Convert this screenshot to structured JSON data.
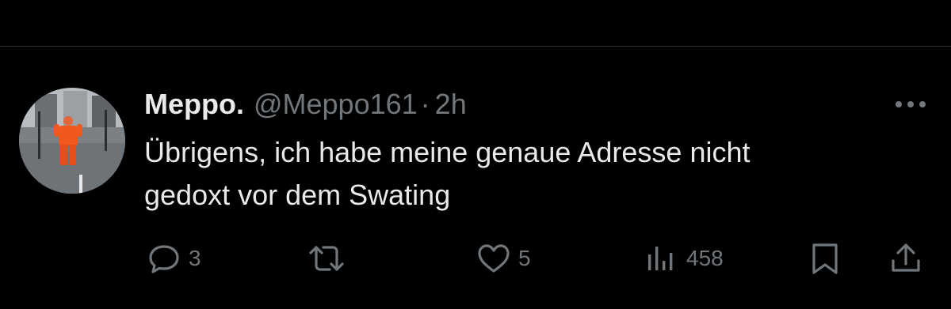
{
  "tweet": {
    "display_name": "Meppo.",
    "handle": "@Meppo161",
    "separator": "·",
    "time": "2h",
    "text": "Übrigens, ich habe meine genaue Adresse nicht\ngedoxt vor dem Swating"
  },
  "actions": {
    "reply_count": "3",
    "retweet_count": "",
    "like_count": "5",
    "view_count": "458"
  },
  "icons": {
    "avatar": "avatar-photo",
    "more": "more-icon",
    "reply": "reply-icon",
    "retweet": "retweet-icon",
    "like": "heart-icon",
    "views": "views-icon",
    "bookmark": "bookmark-icon",
    "share": "share-icon"
  },
  "colors": {
    "background": "#000000",
    "text_primary": "#e7e9ea",
    "text_secondary": "#71767b",
    "divider": "#2f3336"
  }
}
